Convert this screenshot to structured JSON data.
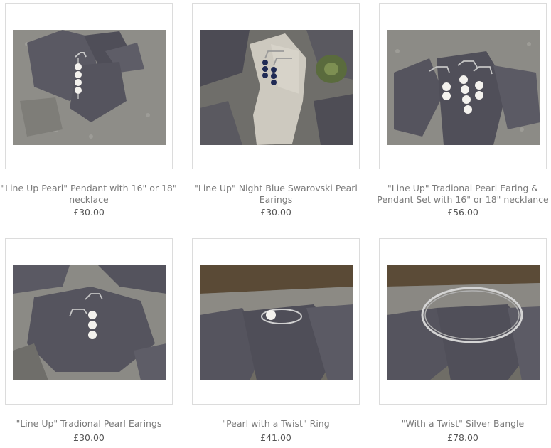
{
  "products": [
    {
      "title": "\"Line Up Pearl\" Pendant with 16\" or 18\" necklace",
      "price": "£30.00",
      "image": "pearl-pendant-photo"
    },
    {
      "title": "\"Line Up\" Night Blue Swarovski Pearl Earings",
      "price": "£30.00",
      "image": "night-blue-earrings-photo"
    },
    {
      "title": "\"Line Up\" Tradional Pearl Earing & Pendant Set with 16\" or 18\" necklance",
      "price": "£56.00",
      "image": "pearl-set-photo"
    },
    {
      "title": "\"Line Up\" Tradional Pearl Earings",
      "price": "£30.00",
      "image": "pearl-earrings-photo"
    },
    {
      "title": "\"Pearl with a Twist\" Ring",
      "price": "£41.00",
      "image": "pearl-ring-photo"
    },
    {
      "title": "\"With a Twist\" Silver Bangle",
      "price": "£78.00",
      "image": "silver-bangle-photo"
    }
  ],
  "colors": {
    "title_text": "#7a7a7a",
    "price_text": "#555555",
    "frame_border": "#dcdcdc",
    "slate": "#55545e",
    "granite": "#8f8f8c",
    "pearl": "#f4f2ee",
    "night_blue": "#1f2a55"
  }
}
